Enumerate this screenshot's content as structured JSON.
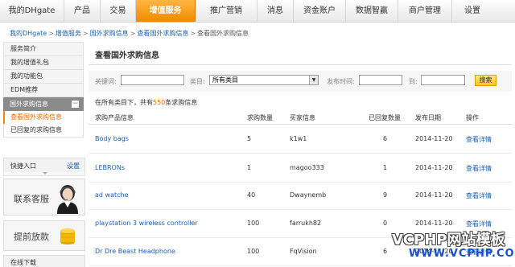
{
  "nav": {
    "items": [
      "我的DHgate",
      "产品",
      "交易",
      "增值服务",
      "推广营销",
      "消息",
      "资金账户",
      "数据智赢",
      "商户管理",
      "设置"
    ],
    "active_index": 3
  },
  "breadcrumb": {
    "items": [
      "我的DHgate",
      "增值服务",
      "国外求购信息",
      "查看国外求购信息",
      "查看国外求购信息"
    ],
    "separator": ">"
  },
  "sidebar": {
    "items": [
      "服务简介",
      "我的增值礼包",
      "我的功能包",
      "EDM推荐"
    ],
    "group_title": "国外求购信息",
    "group_toggle": "−",
    "sub_items": [
      "查看国外求购信息",
      "已回复的求购信息"
    ],
    "quick_title": "快捷入口",
    "quick_settings": "设置",
    "service_label": "联系客服",
    "cash_label": "提前放款",
    "download_label": "在线下载"
  },
  "main": {
    "title": "查看国外求购信息",
    "filter": {
      "keyword_label": "关键词:",
      "category_label": "类目:",
      "category_value": "所有类目",
      "publish_label": "发布时间:",
      "to_label": "到:",
      "search_button": "搜索"
    },
    "summary": {
      "prefix": "在所有类目下，共有",
      "count": "550",
      "suffix": "条求购信息"
    },
    "table": {
      "columns": [
        "求购产品信息",
        "求购数量",
        "买家信息",
        "已回复数量",
        "发布日期",
        "操作"
      ],
      "rows": [
        {
          "product": "Body bags",
          "quantity": "5",
          "buyer": "k1w1",
          "replies": "6",
          "date": "2014-11-20",
          "action": "查看详情"
        },
        {
          "product": "LEBRONs",
          "quantity": "1",
          "buyer": "magoo333",
          "replies": "1",
          "date": "2014-11-20",
          "action": "查看详情"
        },
        {
          "product": "ad watche",
          "quantity": "40",
          "buyer": "Dwaynemb",
          "replies": "9",
          "date": "2014-11-20",
          "action": "查看详情"
        },
        {
          "product": "playstation 3 wireless controller",
          "quantity": "100",
          "buyer": "farrukh82",
          "replies": "0",
          "date": "2014-11-20",
          "action": "查看详情"
        },
        {
          "product": "Dr Dre Beast Headphone",
          "quantity": "100",
          "buyer": "FqVision",
          "replies": "6",
          "date": "2014-11-20",
          "action": "查看详情"
        }
      ]
    }
  },
  "watermark": {
    "line1": "VCPHP网站模板",
    "line2": "WWW.VCPHP.COM"
  },
  "colors": {
    "accent": "#f08a00",
    "link": "#1a5fb4",
    "highlight": "#e56a00"
  }
}
